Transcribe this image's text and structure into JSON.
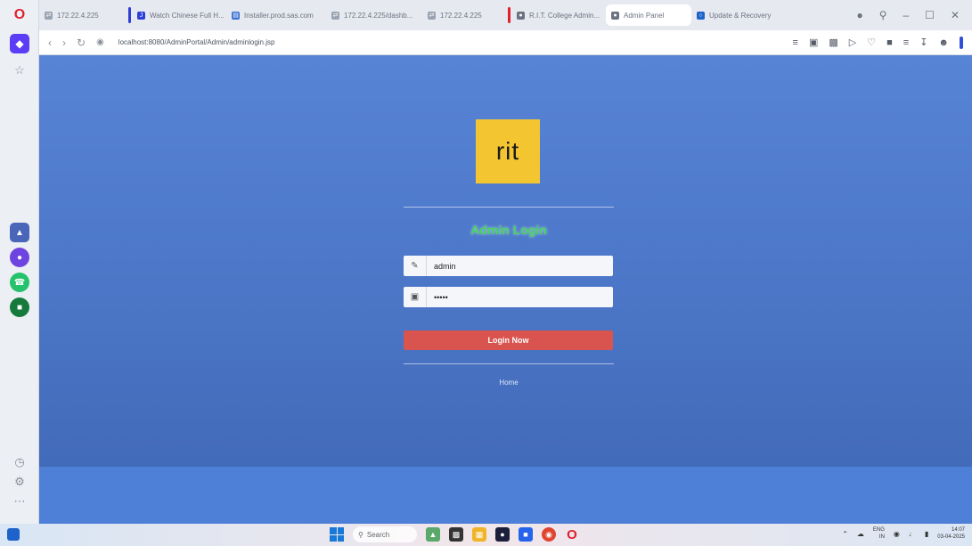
{
  "browser": {
    "tabs": [
      {
        "label": "172.22.4.225",
        "fav": "⇄",
        "color": "#9aa3b2"
      },
      {
        "label": "Watch Chinese Full H...",
        "fav": "J",
        "color": "#2d3fd8",
        "bar": "#2d3fd8"
      },
      {
        "label": "Installer.prod.sas.com",
        "fav": "▤",
        "color": "#3b6fd1"
      },
      {
        "label": "172.22.4.225/dashb...",
        "fav": "⇄",
        "color": "#9aa3b2"
      },
      {
        "label": "172.22.4.225",
        "fav": "⇄",
        "color": "#9aa3b2"
      },
      {
        "label": "R.I.T. College Admin...",
        "fav": "●",
        "color": "#6b7280",
        "bar": "#e0202e"
      },
      {
        "label": "Admin Panel",
        "fav": "●",
        "color": "#6b7280",
        "active": true
      },
      {
        "label": "Update & Recovery",
        "fav": "○",
        "color": "#1e63c9"
      }
    ],
    "url": "localhost:8080/AdminPortal/Admin/adminlogin.jsp"
  },
  "page": {
    "logo_text": "rit",
    "title": "Admin Login",
    "username": {
      "value": "admin",
      "icon": "user-icon"
    },
    "password": {
      "value": "•••••",
      "icon": "lock-icon"
    },
    "login_button": "Login Now",
    "home_link": "Home"
  },
  "taskbar": {
    "search_label": "Search",
    "lang_top": "ENG",
    "lang_bottom": "IN",
    "time": "14:07",
    "date": "03-04-2025"
  },
  "colors": {
    "page_bg_top": "#5884d6",
    "page_bg_bottom": "#3f67b4",
    "logo_bg": "#f3c531",
    "title": "#43d65a",
    "button": "#d9534f"
  }
}
